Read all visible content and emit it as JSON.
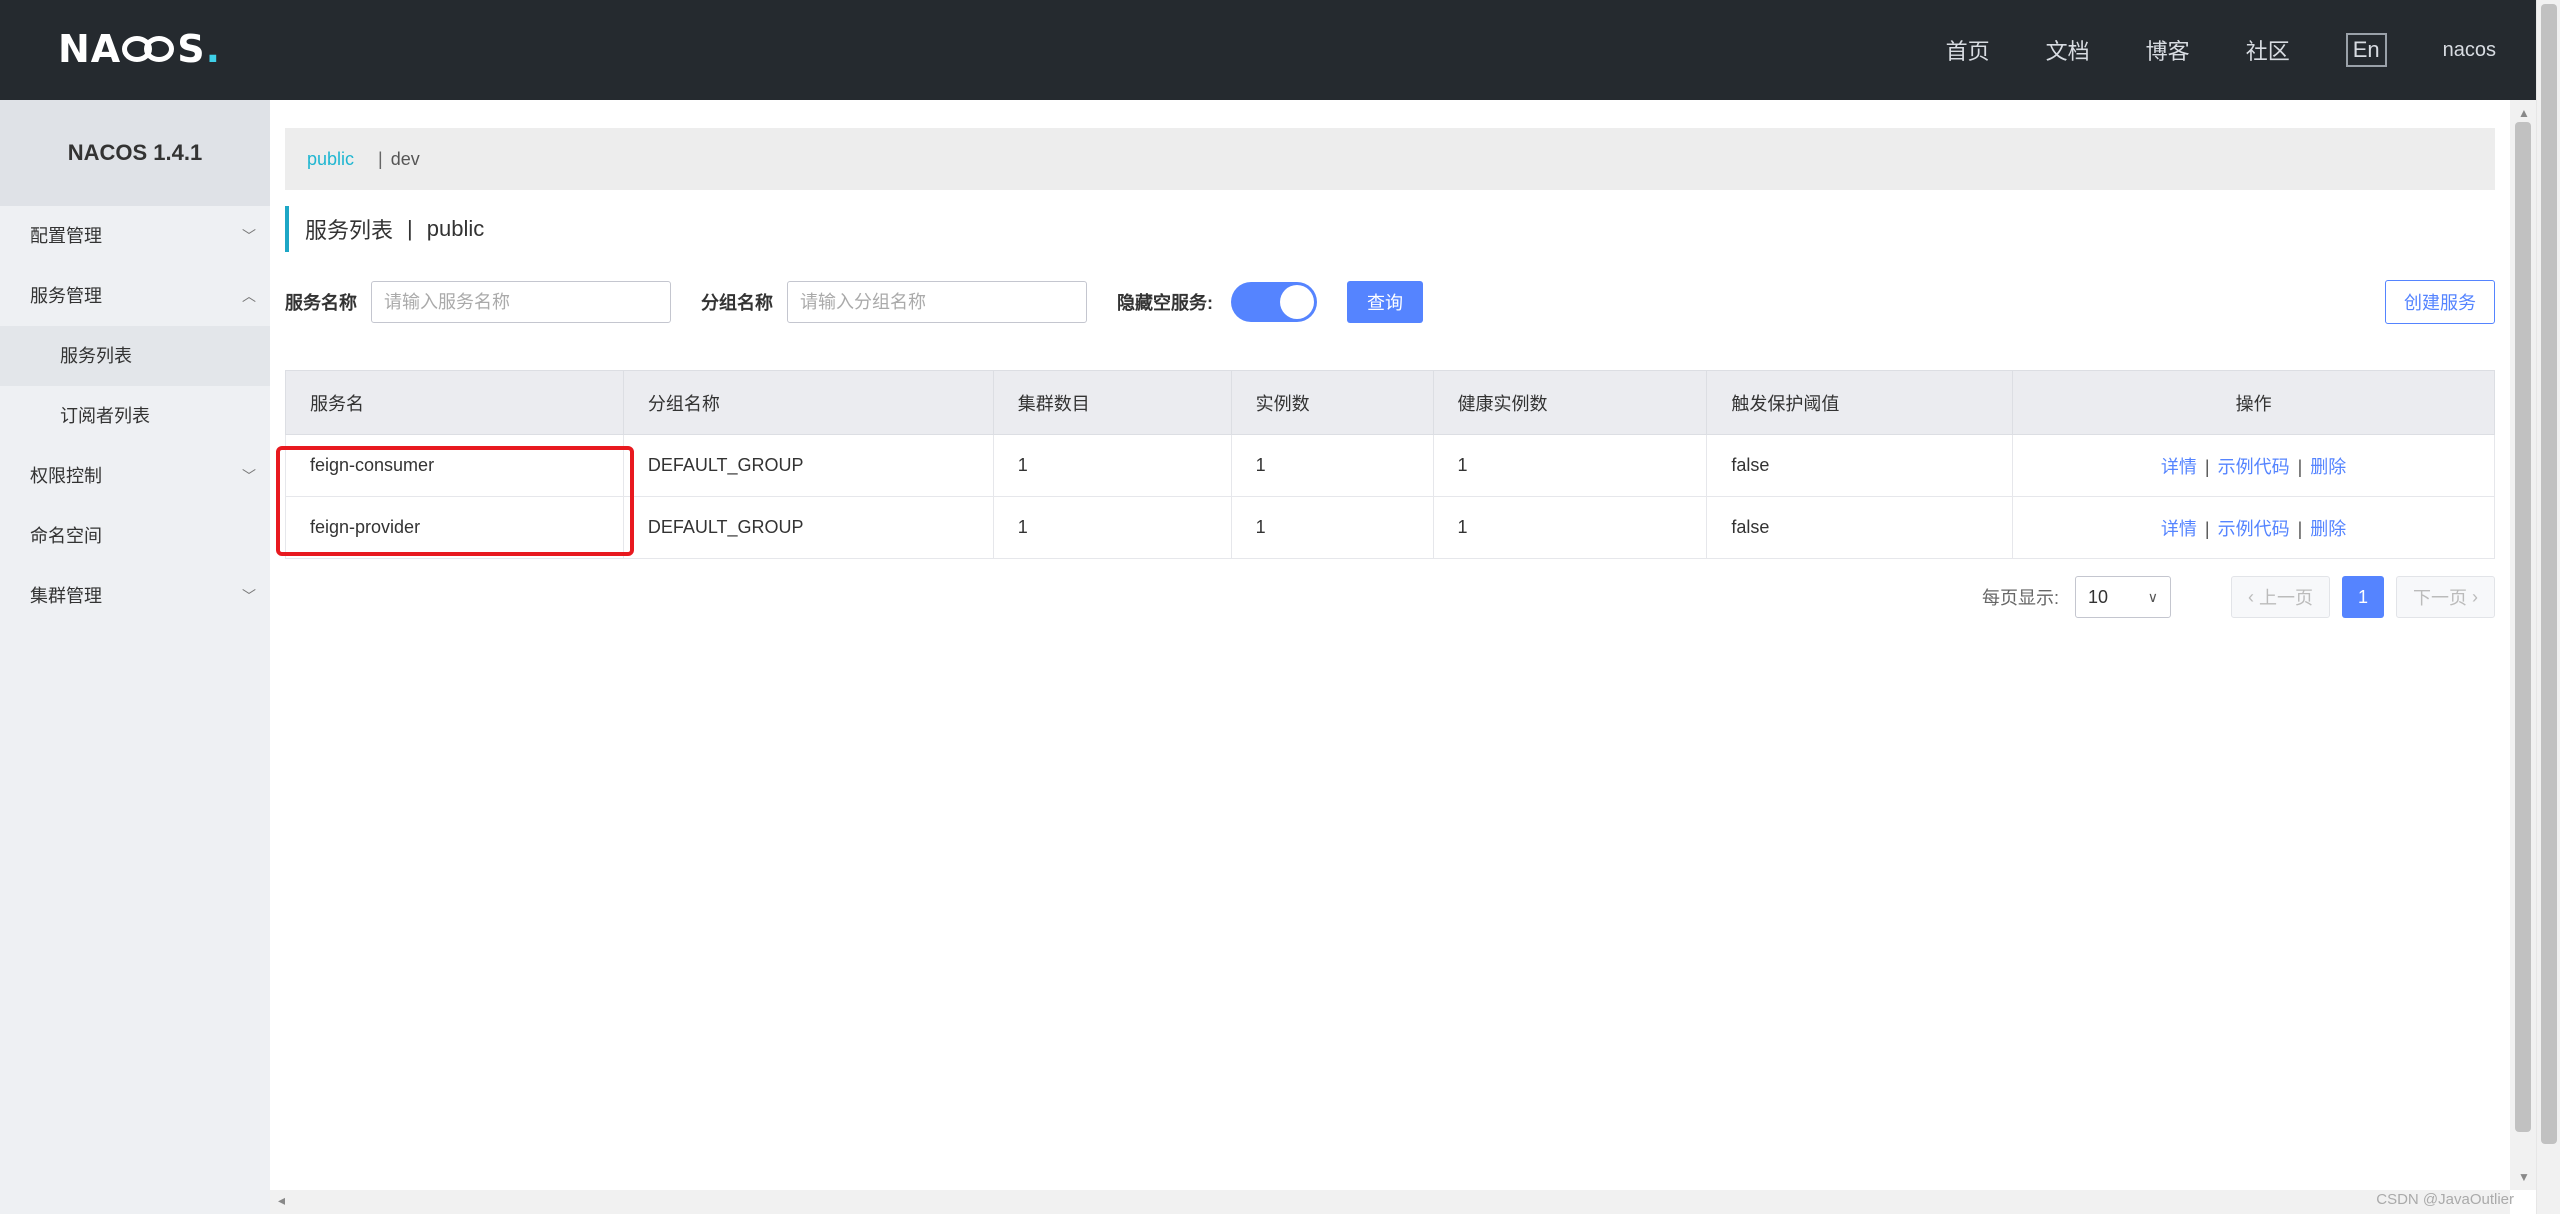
{
  "app": {
    "logo_left": "NA",
    "logo_right": "S",
    "logo_dot": ".",
    "version_title": "NACOS 1.4.1"
  },
  "topnav": {
    "items": [
      "首页",
      "文档",
      "博客",
      "社区"
    ],
    "lang": "En",
    "user": "nacos"
  },
  "sidebar": {
    "items": [
      {
        "label": "配置管理",
        "chevron": "chevron-down-icon"
      },
      {
        "label": "服务管理",
        "chevron": "chevron-up-icon"
      },
      {
        "label": "服务列表",
        "sub": true,
        "active": true
      },
      {
        "label": "订阅者列表",
        "sub": true
      },
      {
        "label": "权限控制",
        "chevron": "chevron-down-icon"
      },
      {
        "label": "命名空间"
      },
      {
        "label": "集群管理",
        "chevron": "chevron-down-icon"
      }
    ]
  },
  "namespaces": {
    "active": "public",
    "separator": "|",
    "other": "dev"
  },
  "page": {
    "title": "服务列表",
    "separator": "|",
    "namespace": "public"
  },
  "filters": {
    "service_name_label": "服务名称",
    "service_name_placeholder": "请输入服务名称",
    "group_name_label": "分组名称",
    "group_name_placeholder": "请输入分组名称",
    "hide_empty_label": "隐藏空服务:",
    "hide_empty_on": true,
    "query_label": "查询",
    "create_label": "创建服务"
  },
  "table": {
    "headers": [
      "服务名",
      "分组名称",
      "集群数目",
      "实例数",
      "健康实例数",
      "触发保护阈值",
      "操作"
    ],
    "rows": [
      {
        "name": "feign-consumer",
        "group": "DEFAULT_GROUP",
        "clusters": "1",
        "instances": "1",
        "healthy": "1",
        "threshold": "false"
      },
      {
        "name": "feign-provider",
        "group": "DEFAULT_GROUP",
        "clusters": "1",
        "instances": "1",
        "healthy": "1",
        "threshold": "false"
      }
    ],
    "ops": {
      "detail": "详情",
      "sample": "示例代码",
      "delete": "删除",
      "sep": "|"
    }
  },
  "pagination": {
    "page_size_label": "每页显示:",
    "page_size": "10",
    "prev": "上一页",
    "next": "下一页",
    "current": "1"
  },
  "watermark": "CSDN @JavaOutlier",
  "colors": {
    "accent": "#5584ff",
    "namespace_active": "#1fb6d1",
    "highlight_box": "#e8191f",
    "topbar": "#252a2f"
  }
}
